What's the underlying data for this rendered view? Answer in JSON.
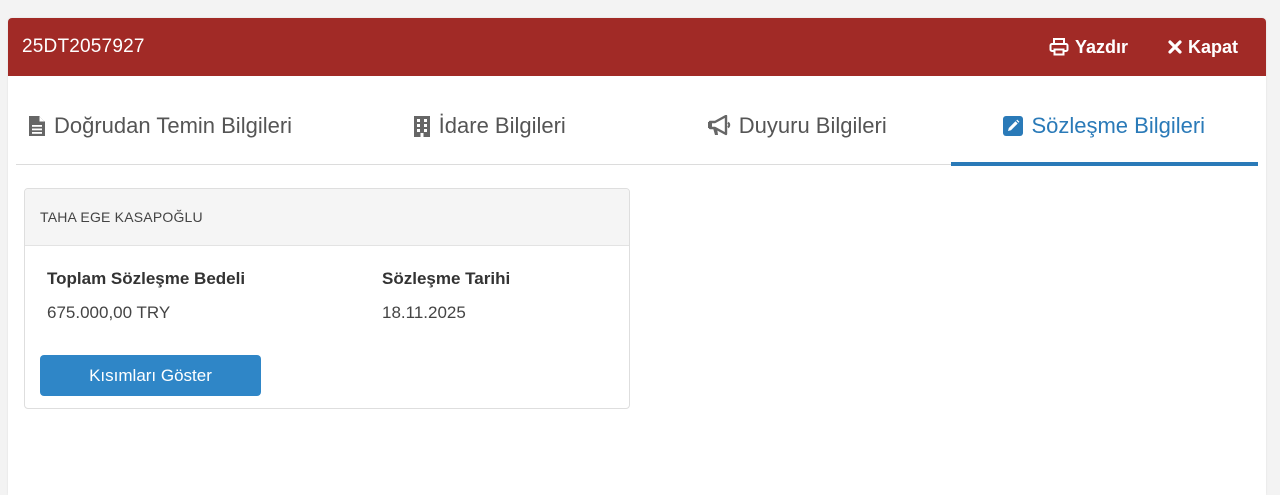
{
  "header": {
    "title": "25DT2057927",
    "print_label": "Yazdır",
    "close_label": "Kapat",
    "background": "#a12a26"
  },
  "tabs": [
    {
      "label": "Doğrudan Temin Bilgileri",
      "icon": "file-text-icon",
      "active": false
    },
    {
      "label": "İdare Bilgileri",
      "icon": "building-icon",
      "active": false
    },
    {
      "label": "Duyuru Bilgileri",
      "icon": "megaphone-icon",
      "active": false
    },
    {
      "label": "Sözleşme Bilgileri",
      "icon": "edit-icon",
      "active": true
    }
  ],
  "accent_color": "#2a7ab8",
  "contract": {
    "party": "TAHA EGE KASAPOĞLU",
    "total_label": "Toplam Sözleşme Bedeli",
    "total_value": "675.000,00 TRY",
    "date_label": "Sözleşme Tarihi",
    "date_value": "18.11.2025",
    "button_label": "Kısımları Göster"
  }
}
